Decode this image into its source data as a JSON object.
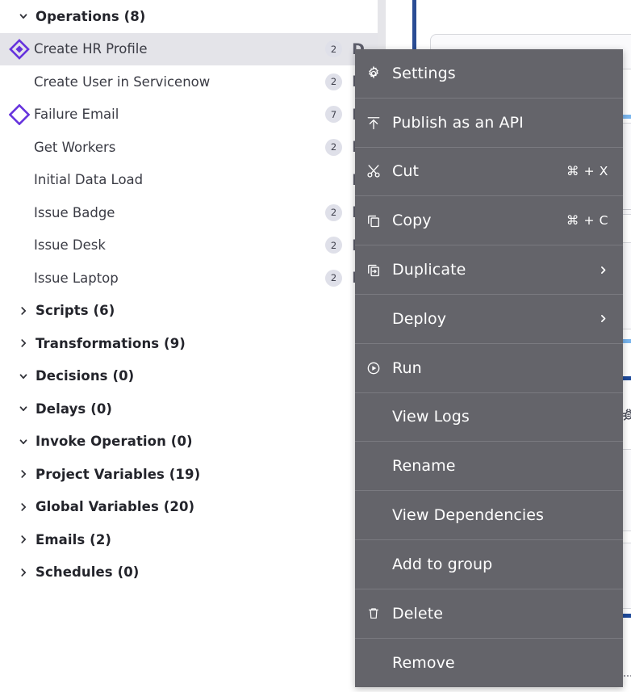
{
  "tree": {
    "groups_and_items": [
      {
        "kind": "group",
        "label": "Operations (8)",
        "count": 8,
        "expanded": true,
        "chevron": "chevron-down-icon"
      },
      {
        "kind": "item",
        "label": "Create HR Profile",
        "badge": "2",
        "deploy_flag": "D",
        "icon": "diamond-filled-icon",
        "selected": true
      },
      {
        "kind": "item",
        "label": "Create User in Servicenow",
        "badge": "2",
        "deploy_flag": "D",
        "icon": "none",
        "selected": false
      },
      {
        "kind": "item",
        "label": "Failure Email",
        "badge": "7",
        "deploy_flag": "D",
        "icon": "diamond-outline-icon",
        "selected": false
      },
      {
        "kind": "item",
        "label": "Get Workers",
        "badge": "2",
        "deploy_flag": "D",
        "icon": "none",
        "selected": false
      },
      {
        "kind": "item",
        "label": "Initial Data Load",
        "badge": "",
        "deploy_flag": "D",
        "icon": "none",
        "selected": false
      },
      {
        "kind": "item",
        "label": "Issue Badge",
        "badge": "2",
        "deploy_flag": "D",
        "icon": "none",
        "selected": false
      },
      {
        "kind": "item",
        "label": "Issue Desk",
        "badge": "2",
        "deploy_flag": "D",
        "icon": "none",
        "selected": false
      },
      {
        "kind": "item",
        "label": "Issue Laptop",
        "badge": "2",
        "deploy_flag": "D",
        "icon": "none",
        "selected": false
      },
      {
        "kind": "group",
        "label": "Scripts (6)",
        "count": 6,
        "expanded": false,
        "chevron": "chevron-right-icon"
      },
      {
        "kind": "group",
        "label": "Transformations (9)",
        "count": 9,
        "expanded": false,
        "chevron": "chevron-right-icon"
      },
      {
        "kind": "group",
        "label": "Decisions (0)",
        "count": 0,
        "expanded": true,
        "chevron": "chevron-down-icon"
      },
      {
        "kind": "group",
        "label": "Delays (0)",
        "count": 0,
        "expanded": true,
        "chevron": "chevron-down-icon"
      },
      {
        "kind": "group",
        "label": "Invoke Operation (0)",
        "count": 0,
        "expanded": true,
        "chevron": "chevron-down-icon"
      },
      {
        "kind": "group",
        "label": "Project Variables (19)",
        "count": 19,
        "expanded": false,
        "chevron": "chevron-right-icon"
      },
      {
        "kind": "group",
        "label": "Global Variables (20)",
        "count": 20,
        "expanded": false,
        "chevron": "chevron-right-icon"
      },
      {
        "kind": "group",
        "label": "Emails (2)",
        "count": 2,
        "expanded": false,
        "chevron": "chevron-right-icon"
      },
      {
        "kind": "group",
        "label": "Schedules (0)",
        "count": 0,
        "expanded": false,
        "chevron": "chevron-right-icon"
      }
    ]
  },
  "context_menu": {
    "items": [
      {
        "label": "Settings",
        "icon": "gear-icon",
        "shortcut": "",
        "submenu": false
      },
      {
        "label": "Publish as an API",
        "icon": "publish-icon",
        "shortcut": "",
        "submenu": false
      },
      {
        "label": "Cut",
        "icon": "scissors-icon",
        "shortcut": "⌘ + X",
        "submenu": false
      },
      {
        "label": "Copy",
        "icon": "copy-icon",
        "shortcut": "⌘ + C",
        "submenu": false
      },
      {
        "label": "Duplicate",
        "icon": "duplicate-icon",
        "shortcut": "",
        "submenu": true
      },
      {
        "label": "Deploy",
        "icon": "none",
        "shortcut": "",
        "submenu": true
      },
      {
        "label": "Run",
        "icon": "run-icon",
        "shortcut": "",
        "submenu": false
      },
      {
        "label": "View Logs",
        "icon": "none",
        "shortcut": "",
        "submenu": false
      },
      {
        "label": "Rename",
        "icon": "none",
        "shortcut": "",
        "submenu": false
      },
      {
        "label": "View Dependencies",
        "icon": "none",
        "shortcut": "",
        "submenu": false
      },
      {
        "label": "Add to group",
        "icon": "none",
        "shortcut": "",
        "submenu": false
      },
      {
        "label": "Delete",
        "icon": "trash-icon",
        "shortcut": "",
        "submenu": false
      },
      {
        "label": "Remove",
        "icon": "none",
        "shortcut": "",
        "submenu": false
      }
    ]
  },
  "colors": {
    "menu_background": "#64646a",
    "menu_separator": "#7a7a80",
    "menu_text": "#ffffff",
    "selected_row": "#e4e4e9",
    "diamond_accent": "#6633dd",
    "badge_background": "#dfe0e9",
    "deploy_flag": "#5d5e6b",
    "rail_blue": "#2a4c94",
    "bar_light_blue": "#7ab6ee",
    "bar_dark_blue": "#1f4b9b"
  }
}
